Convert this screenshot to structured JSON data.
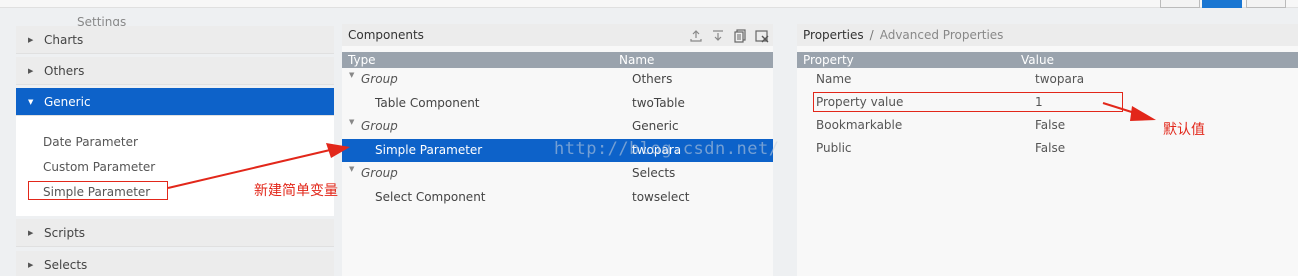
{
  "left": {
    "title": "Settings",
    "sections": {
      "charts": "Charts",
      "others": "Others",
      "generic": "Generic",
      "scripts": "Scripts",
      "selects": "Selects"
    },
    "generic_items": [
      "Date Parameter",
      "Custom Parameter",
      "Simple Parameter"
    ]
  },
  "components": {
    "title": "Components",
    "columns": {
      "type": "Type",
      "name": "Name"
    },
    "rows": [
      {
        "type": "Group",
        "name": "Others",
        "group": true
      },
      {
        "type": "Table Component",
        "name": "twoTable",
        "group": false
      },
      {
        "type": "Group",
        "name": "Generic",
        "group": true
      },
      {
        "type": "Simple Parameter",
        "name": "twopara",
        "group": false,
        "selected": true
      },
      {
        "type": "Group",
        "name": "Selects",
        "group": true
      },
      {
        "type": "Select Component",
        "name": "towselect",
        "group": false
      }
    ],
    "watermark": "http://blog.csdn.net/"
  },
  "properties": {
    "title": "Properties",
    "separator": "/",
    "advanced": "Advanced Properties",
    "columns": {
      "property": "Property",
      "value": "Value"
    },
    "rows": [
      {
        "property": "Name",
        "value": "twopara"
      },
      {
        "property": "Property value",
        "value": "1"
      },
      {
        "property": "Bookmarkable",
        "value": "False"
      },
      {
        "property": "Public",
        "value": "False"
      }
    ]
  },
  "annotations": {
    "new_simple_variable": "新建简单变量",
    "default_value": "默认值"
  },
  "colors": {
    "selection": "#0d62c9",
    "annotation_red": "#e2271a",
    "column_header": "#9aa3ad"
  },
  "icons": [
    "export-icon",
    "import-icon",
    "copy-icon",
    "delete-icon"
  ]
}
